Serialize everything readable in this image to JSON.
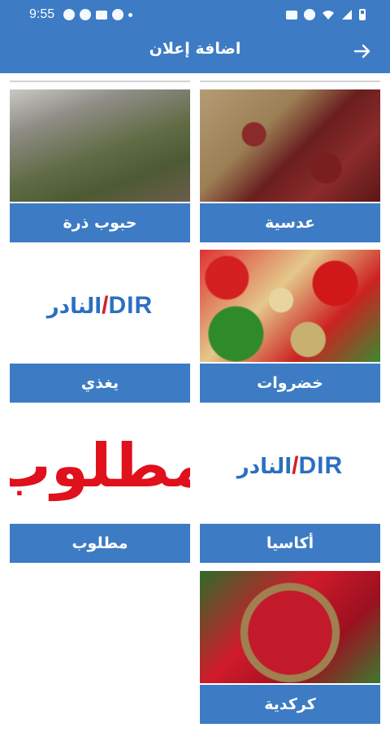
{
  "status_bar": {
    "time": "9:55",
    "left_icons": [
      "whatsapp-icon",
      "messenger-icon",
      "cast-icon",
      "skype-icon",
      "dot-icon"
    ],
    "right_icons": [
      "lock-icon",
      "alarm-icon",
      "wifi-icon",
      "signal-icon",
      "battery-icon"
    ]
  },
  "app_bar": {
    "title": "اضافة إعلان",
    "back_icon": "arrow-right-icon"
  },
  "colors": {
    "primary": "#3d7cc4",
    "logo_blue": "#2a6fc1",
    "logo_red": "#d4202a",
    "wanted_red": "#e0101c"
  },
  "categories": [
    {
      "label": "عدسية",
      "image": "lentils-photo"
    },
    {
      "label": "حبوب ذرة",
      "image": "sorghum-photo"
    },
    {
      "label": "خضروات",
      "image": "vegetables-photo"
    },
    {
      "label": "يغذي",
      "image": "nadir-logo",
      "logo_latin": "DIR",
      "logo_arabic": "النادر"
    },
    {
      "label": "أكاسيا",
      "image": "nadir-logo",
      "logo_latin": "DIR",
      "logo_arabic": "النادر"
    },
    {
      "label": "مطلوب",
      "image": "wanted-banner",
      "banner_text": "مطلوب"
    },
    {
      "label": "كركدية",
      "image": "hibiscus-photo"
    }
  ]
}
